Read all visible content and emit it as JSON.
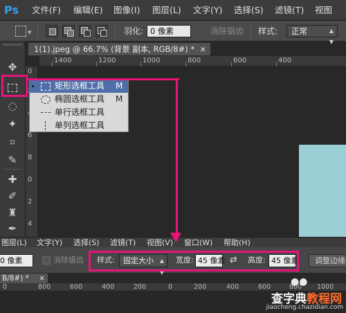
{
  "app": {
    "logo": "Ps"
  },
  "menu": [
    "文件(F)",
    "编辑(E)",
    "图像(I)",
    "图层(L)",
    "文字(Y)",
    "选择(S)",
    "滤镜(T)",
    "视图"
  ],
  "options": {
    "feather_label": "羽化:",
    "feather_value": "0 像素",
    "antialias_label": "消除锯齿",
    "style_label": "样式:",
    "style_value": "正常"
  },
  "document": {
    "tab_title": "1(1).jpeg @ 66.7% (背景 副本, RGB/8#) *",
    "close_glyph": "×"
  },
  "ruler_top": [
    "1400",
    "1200",
    "1000",
    "800",
    "600",
    "400"
  ],
  "ruler_left": [
    "0",
    "2",
    "4",
    "6",
    "8",
    "0",
    "2",
    "4"
  ],
  "flyout": {
    "items": [
      {
        "label": "矩形选框工具",
        "key": "M"
      },
      {
        "label": "椭圆选框工具",
        "key": "M"
      },
      {
        "label": "单行选框工具",
        "key": ""
      },
      {
        "label": "单列选框工具",
        "key": ""
      }
    ]
  },
  "menu2": [
    "图层(L)",
    "文字(Y)",
    "选择(S)",
    "滤镜(T)",
    "视图(V)",
    "窗口(W)",
    "帮助(H)"
  ],
  "options2": {
    "feather_value": "0 像素",
    "antialias_label": "消除锯齿",
    "style_label": "样式:",
    "style_value": "固定大小",
    "width_label": "宽度:",
    "width_value": "45 像素",
    "height_label": "高度:",
    "height_value": "45 像素",
    "swap_glyph": "⇄",
    "refine_edge": "调整边缘"
  },
  "document2": {
    "tab_title": "B/8#) *",
    "close_glyph": "×"
  },
  "ruler_top2": [
    "0",
    "800",
    "600",
    "400",
    "200",
    "0",
    "200",
    "400",
    "600",
    "800",
    "1000",
    "1200"
  ],
  "watermark": {
    "brand": "查字典",
    "sub": "教程网",
    "url": "jiaocheng.chazidian.com"
  },
  "colors": {
    "annotation": "#e8147a",
    "canvas_image": "#9bcfd6",
    "highlight": "#4f6fa8"
  }
}
